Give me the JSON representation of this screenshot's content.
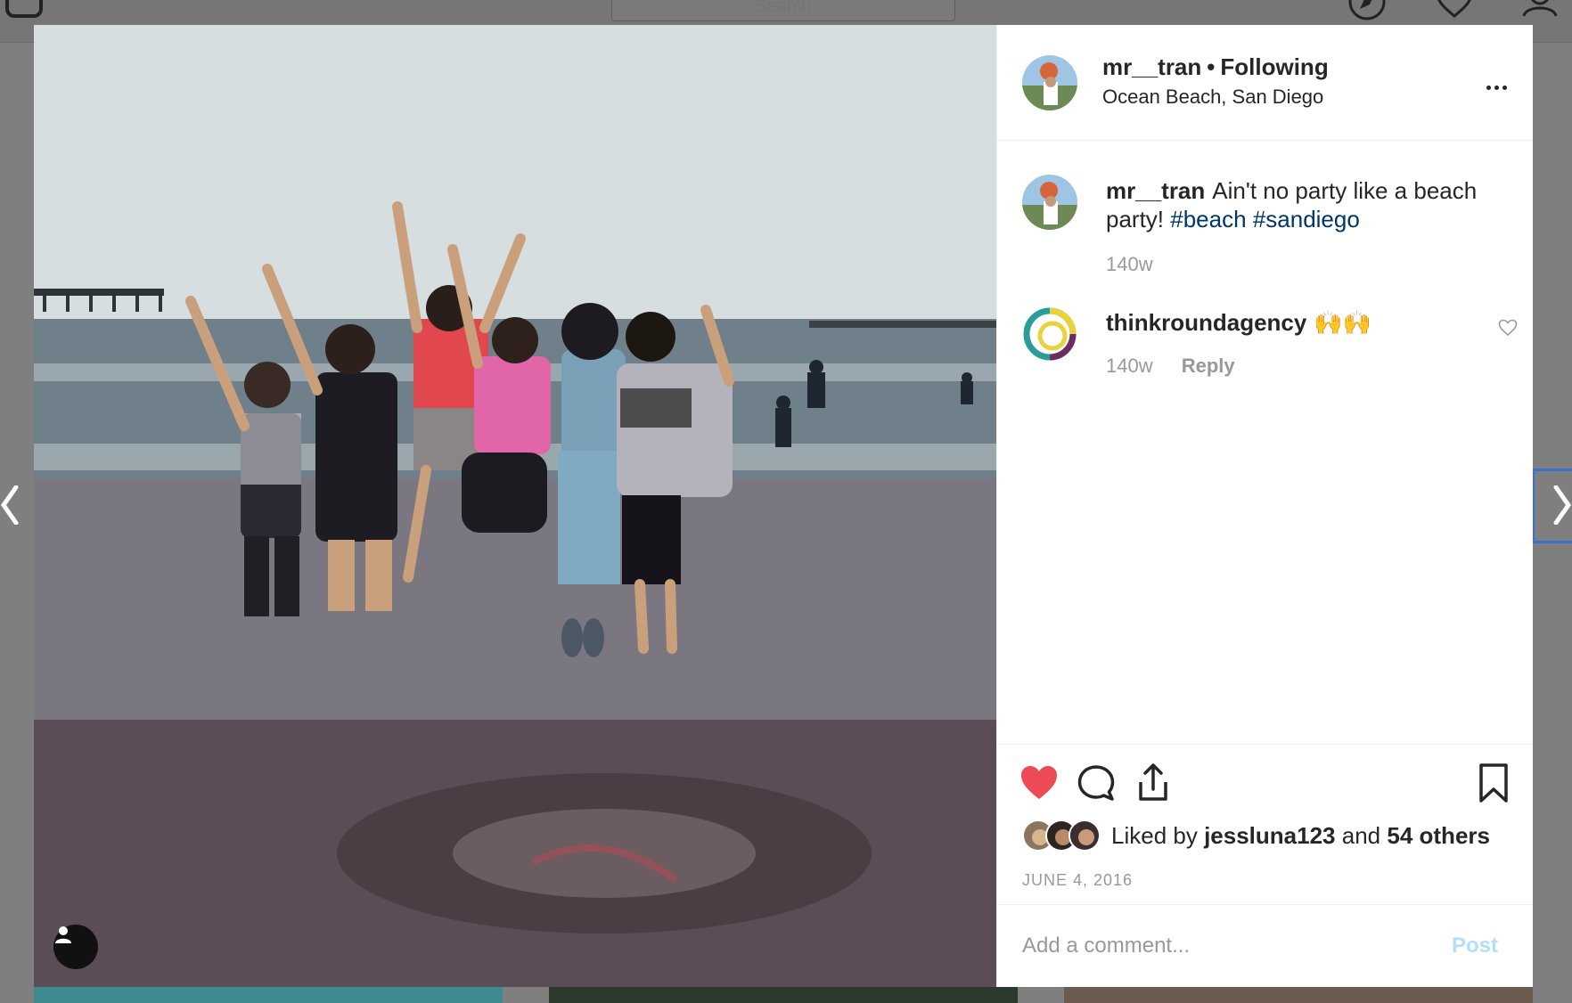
{
  "nav": {
    "search_placeholder": "Search",
    "icons": [
      "instagram-logo-icon",
      "compass-icon",
      "heart-icon",
      "person-icon"
    ]
  },
  "post": {
    "username": "mr__tran",
    "follow_status": "Following",
    "location": "Ocean Beach, San Diego",
    "caption": {
      "username": "mr__tran",
      "text": "Ain't no party like a beach party!",
      "hashtags": [
        "#beach",
        "#sandiego"
      ],
      "age": "140w"
    },
    "comments": [
      {
        "username": "thinkroundagency",
        "text": "🙌🙌",
        "age": "140w",
        "reply_label": "Reply"
      }
    ],
    "likes": {
      "prefix": "Liked by",
      "user": "jessluna123",
      "connector": "and",
      "others": "54 others"
    },
    "date": "JUNE 4, 2016",
    "liked": true
  },
  "comment_box": {
    "placeholder": "Add a comment...",
    "post_label": "Post"
  },
  "colors": {
    "heart_active": "#ed4956",
    "hashtag": "#003569",
    "post_button_disabled": "#b2dffc",
    "meta_text": "#999999"
  }
}
